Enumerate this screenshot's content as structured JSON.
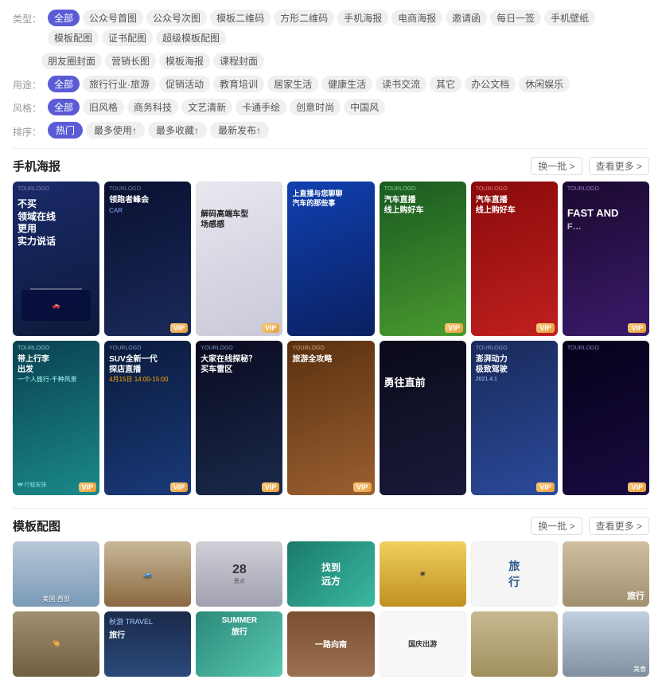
{
  "filters": {
    "type_label": "类型：",
    "source_label": "用途：",
    "style_label": "风格：",
    "sort_label": "排序：",
    "type_tags": [
      {
        "label": "全部",
        "active": true
      },
      {
        "label": "公众号首图",
        "active": false
      },
      {
        "label": "公众号次图",
        "active": false
      },
      {
        "label": "模板二维码",
        "active": false
      },
      {
        "label": "方形二维码",
        "active": false
      },
      {
        "label": "手机海报",
        "active": false
      },
      {
        "label": "电商海报",
        "active": false
      },
      {
        "label": "邀请函",
        "active": false
      },
      {
        "label": "每日一签",
        "active": false
      },
      {
        "label": "手机壁纸",
        "active": false
      },
      {
        "label": "模板配图",
        "active": false
      },
      {
        "label": "证书配图",
        "active": false
      },
      {
        "label": "超级模板配图",
        "active": false
      }
    ],
    "type_tags2": [
      {
        "label": "朋友圈封面",
        "active": false
      },
      {
        "label": "营销长图",
        "active": false
      },
      {
        "label": "模板海报",
        "active": false
      },
      {
        "label": "课程封面",
        "active": false
      }
    ],
    "source_tags": [
      {
        "label": "全部",
        "active": true
      },
      {
        "label": "旅行行业·旅游",
        "active": false
      },
      {
        "label": "促销活动",
        "active": false
      },
      {
        "label": "教育培训",
        "active": false
      },
      {
        "label": "居家生活",
        "active": false
      },
      {
        "label": "健康生活",
        "active": false
      },
      {
        "label": "读书交流",
        "active": false
      },
      {
        "label": "其它",
        "active": false
      },
      {
        "label": "办公文档",
        "active": false
      },
      {
        "label": "休闲娱乐",
        "active": false
      }
    ],
    "style_tags": [
      {
        "label": "全部",
        "active": true
      },
      {
        "label": "旧风格",
        "active": false
      },
      {
        "label": "商务科技",
        "active": false
      },
      {
        "label": "文艺清新",
        "active": false
      },
      {
        "label": "卡通手绘",
        "active": false
      },
      {
        "label": "创意时尚",
        "active": false
      },
      {
        "label": "中国风",
        "active": false
      }
    ],
    "sort_buttons": [
      {
        "label": "热门",
        "active": true
      },
      {
        "label": "最多使用↑",
        "active": false
      },
      {
        "label": "最多收藏↑",
        "active": false
      },
      {
        "label": "最新发布↑",
        "active": false
      }
    ]
  },
  "sections": [
    {
      "id": "phone-poster",
      "title": "手机海报",
      "action1": "换一批 >",
      "action2": "查看更多 >",
      "cards_row1": [
        {
          "bg": "dark-blue",
          "text1": "不买",
          "text2": "领域在线",
          "text3": "更用",
          "text4": "实力说话",
          "has_vip": false,
          "color": "#1a2a5a"
        },
        {
          "bg": "dark-car",
          "text1": "领跑者峰会",
          "text2": "",
          "has_vip": true,
          "color": "#0d1a3a"
        },
        {
          "bg": "white-card",
          "text1": "解码高端车型",
          "text2": "场感感",
          "has_vip": true,
          "color": "#f0f0f0"
        },
        {
          "bg": "blue-grad",
          "text1": "上直播与您聊聊",
          "text2": "汽车的那些事",
          "has_vip": false,
          "color": "#1040a0"
        },
        {
          "bg": "green",
          "text1": "汽车直播",
          "text2": "线上购好车",
          "has_vip": true,
          "color": "#2a5a2a"
        },
        {
          "bg": "red-dark",
          "text1": "汽车直播",
          "text2": "线上购好车",
          "has_vip": true,
          "color": "#8a1a1a"
        },
        {
          "bg": "dark-purple",
          "text1": "FAST AND",
          "text2": "F…",
          "has_vip": true,
          "color": "#1a0a30"
        }
      ],
      "cards_row2": [
        {
          "bg": "teal",
          "text1": "带上行李",
          "text2": "出发",
          "has_vip": true,
          "color": "#0a4050"
        },
        {
          "bg": "dark-blue",
          "text1": "SUV全新一代",
          "text2": "探店直播",
          "has_vip": true,
          "color": "#0a1a3a"
        },
        {
          "bg": "dark-car2",
          "text1": "大家在线探秘？",
          "text2": "买车雷区",
          "has_vip": true,
          "color": "#0a0a20"
        },
        {
          "bg": "brown",
          "text1": "旅游全攻略",
          "text2": "",
          "has_vip": true,
          "color": "#5a3010"
        },
        {
          "bg": "dark-car2",
          "text1": "勇往直前",
          "text2": "",
          "has_vip": false,
          "color": "#0a0a1a"
        },
        {
          "bg": "travel",
          "text1": "澎湃动力",
          "text2": "极致驾驶",
          "has_vip": true,
          "color": "#1a2a5a"
        },
        {
          "bg": "dark-purple",
          "text1": "",
          "text2": "",
          "has_vip": true,
          "color": "#0a0520"
        }
      ]
    },
    {
      "id": "template-photos",
      "title": "模板配图",
      "action1": "换一批 >",
      "action2": "查看更多 >",
      "cards_row1": [
        {
          "bg": "landscape",
          "text1": "",
          "has_vip": false,
          "color": "#8090a0"
        },
        {
          "bg": "landscape2",
          "text1": "",
          "has_vip": false,
          "color": "#907050"
        },
        {
          "bg": "gray",
          "text1": "28",
          "has_vip": false,
          "color": "#c0c0c0"
        },
        {
          "bg": "teal",
          "text1": "找到",
          "text2": "远方",
          "has_vip": false,
          "color": "#2a7a6a"
        },
        {
          "bg": "yellow",
          "text1": "",
          "has_vip": false,
          "color": "#d0a020"
        },
        {
          "bg": "white2",
          "text1": "旅",
          "text2": "行",
          "has_vip": false,
          "color": "#f0f0f0"
        },
        {
          "bg": "landscape3",
          "text1": "旅",
          "text2": "行",
          "has_vip": false,
          "color": "#c0b090"
        }
      ],
      "cards_row2": [
        {
          "bg": "landscape2",
          "text1": "",
          "has_vip": false,
          "color": "#a08060"
        },
        {
          "bg": "dark-blue",
          "text1": "秋游",
          "text2": "旅行",
          "has_vip": false,
          "color": "#1a2a4a"
        },
        {
          "bg": "teal",
          "text1": "SUMMER",
          "text2": "旅行",
          "has_vip": false,
          "color": "#2a8a7a"
        },
        {
          "bg": "brown",
          "text1": "一路向南",
          "has_vip": false,
          "color": "#6a4020"
        },
        {
          "bg": "white2",
          "text1": "国庆出游",
          "has_vip": false,
          "color": "#f5f5f5"
        },
        {
          "bg": "landscape3",
          "text1": "",
          "has_vip": false,
          "color": "#c8b898"
        },
        {
          "bg": "landscape",
          "text1": "",
          "has_vip": false,
          "color": "#90a0b0"
        }
      ]
    }
  ],
  "colors": {
    "accent": "#5b5bd6",
    "vip_gold": "#e8a030"
  }
}
